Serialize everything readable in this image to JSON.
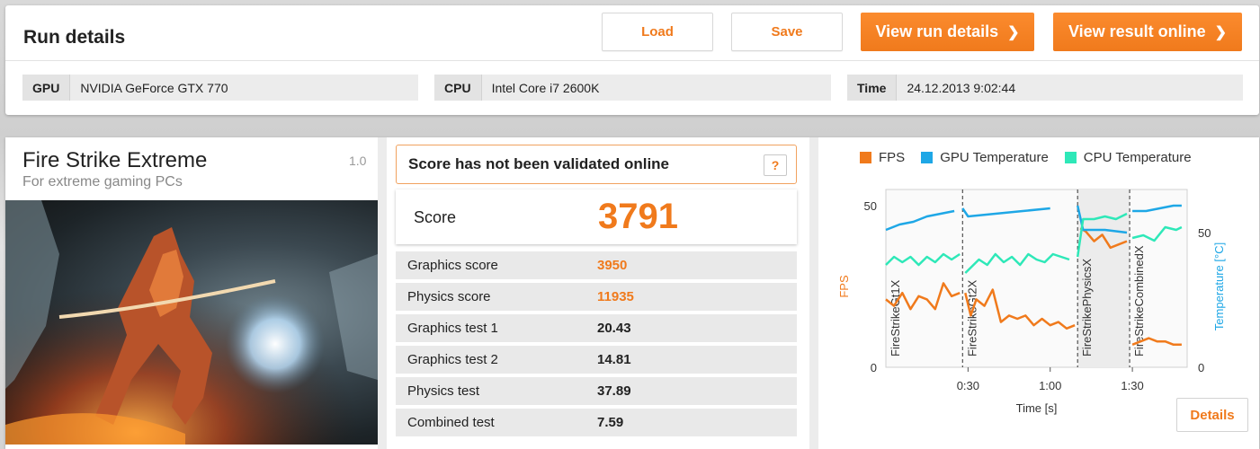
{
  "header": {
    "title": "Run details",
    "load_label": "Load",
    "save_label": "Save",
    "view_run_label": "View run details",
    "view_online_label": "View result online"
  },
  "system": {
    "gpu_label": "GPU",
    "gpu_value": "NVIDIA GeForce GTX 770",
    "cpu_label": "CPU",
    "cpu_value": "Intel Core i7 2600K",
    "time_label": "Time",
    "time_value": "24.12.2013 9:02:44"
  },
  "benchmark": {
    "name": "Fire Strike Extreme",
    "subtitle": "For extreme gaming PCs",
    "version": "1.0"
  },
  "validation": {
    "message": "Score has not been validated online",
    "help_label": "?"
  },
  "score": {
    "label": "Score",
    "value": "3791"
  },
  "results": [
    {
      "label": "Graphics score",
      "value": "3950",
      "highlight": true
    },
    {
      "label": "Physics score",
      "value": "11935",
      "highlight": true
    },
    {
      "label": "Graphics test 1",
      "value": "20.43",
      "highlight": false
    },
    {
      "label": "Graphics test 2",
      "value": "14.81",
      "highlight": false
    },
    {
      "label": "Physics test",
      "value": "37.89",
      "highlight": false
    },
    {
      "label": "Combined test",
      "value": "7.59",
      "highlight": false
    }
  ],
  "colors": {
    "accent": "#f07a1c",
    "gpu_temp": "#1ea7e6",
    "cpu_temp": "#2ee8b8"
  },
  "chart_data": {
    "type": "line",
    "xlabel": "Time [s]",
    "ylabel_left": "FPS",
    "ylabel_right": "Temperature [°C]",
    "x_ticks": [
      "0:30",
      "1:00",
      "1:30"
    ],
    "y_left_ticks": [
      "0",
      "50"
    ],
    "y_right_ticks": [
      "0",
      "50"
    ],
    "legend": [
      "FPS",
      "GPU Temperature",
      "CPU Temperature"
    ],
    "sections": [
      "FireStrikeGt1X",
      "FireStrikeGt2X",
      "FireStrikePhysicsX",
      "FireStrikeCombinedX"
    ],
    "section_bounds_s": [
      0,
      28,
      70,
      89,
      110
    ],
    "xlim": [
      0,
      110
    ],
    "ylim_left": [
      0,
      50
    ],
    "ylim_right": [
      0,
      60
    ],
    "series": [
      {
        "name": "FPS",
        "axis": "left",
        "x": [
          0,
          3,
          6,
          9,
          12,
          15,
          18,
          21,
          24,
          27,
          29,
          31,
          33,
          36,
          39,
          42,
          45,
          48,
          51,
          54,
          57,
          60,
          63,
          66,
          69,
          71,
          73,
          76,
          79,
          82,
          85,
          88,
          90,
          93,
          96,
          99,
          102,
          105,
          108
        ],
        "values": [
          21,
          19,
          23,
          18,
          22,
          21,
          18,
          26,
          22,
          23,
          23,
          16,
          21,
          19,
          24,
          14,
          16,
          15,
          16,
          13,
          15,
          13,
          14,
          12,
          13,
          43,
          42,
          39,
          41,
          37,
          38,
          39,
          7,
          8,
          9,
          8,
          8,
          7,
          7
        ]
      },
      {
        "name": "GPU Temperature",
        "axis": "right",
        "x": [
          0,
          5,
          10,
          15,
          20,
          25,
          28,
          30,
          40,
          50,
          60,
          70,
          72,
          80,
          88,
          90,
          95,
          100,
          105,
          108
        ],
        "values": [
          51,
          53,
          54,
          56,
          57,
          58,
          59,
          56,
          57,
          58,
          59,
          60,
          51,
          51,
          50,
          58,
          58,
          59,
          60,
          60
        ]
      },
      {
        "name": "CPU Temperature",
        "axis": "right",
        "x": [
          0,
          3,
          6,
          9,
          12,
          15,
          18,
          21,
          24,
          27,
          29,
          31,
          34,
          37,
          40,
          43,
          46,
          49,
          52,
          55,
          58,
          61,
          64,
          67,
          70,
          72,
          76,
          80,
          84,
          88,
          90,
          94,
          98,
          102,
          106,
          108
        ],
        "values": [
          38,
          41,
          39,
          41,
          38,
          41,
          39,
          42,
          40,
          42,
          35,
          37,
          40,
          38,
          42,
          39,
          41,
          38,
          42,
          40,
          39,
          42,
          41,
          40,
          41,
          55,
          55,
          56,
          55,
          57,
          48,
          49,
          47,
          52,
          51,
          52
        ]
      }
    ]
  }
}
